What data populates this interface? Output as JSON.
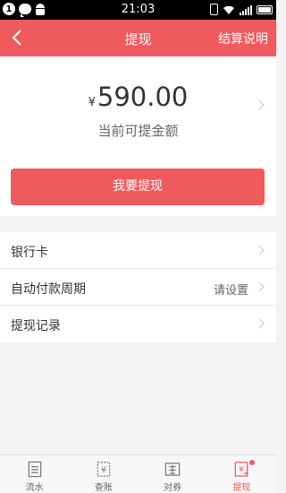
{
  "status_bar": {
    "notification_count": "1",
    "time": "21:03"
  },
  "nav": {
    "title": "提现",
    "right_action": "结算说明"
  },
  "balance": {
    "currency_symbol": "¥",
    "amount": "590.00",
    "label": "当前可提金额"
  },
  "withdraw_button": "我要提现",
  "menu": {
    "bank_card": "银行卡",
    "auto_payment_cycle": "自动付款周期",
    "auto_payment_cycle_value": "请设置",
    "withdraw_records": "提现记录"
  },
  "tabs": [
    {
      "label": "流水",
      "icon": "ledger-icon"
    },
    {
      "label": "查账",
      "icon": "yen-document-icon"
    },
    {
      "label": "对券",
      "icon": "coupon-icon"
    },
    {
      "label": "提现",
      "icon": "withdraw-icon",
      "active": true
    }
  ],
  "colors": {
    "brand": "#ef5a5d",
    "background": "#f3f3f5"
  }
}
